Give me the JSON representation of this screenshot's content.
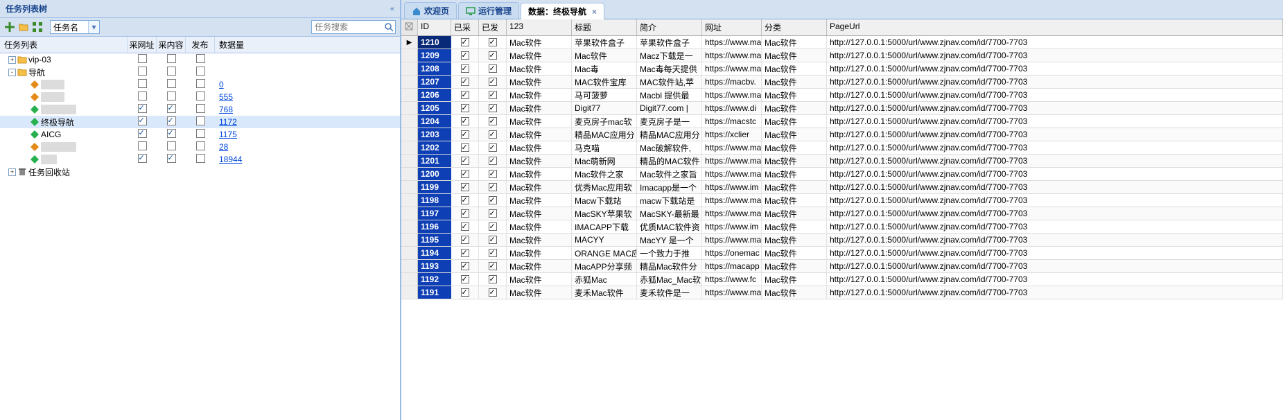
{
  "left": {
    "panel_title": "任务列表树",
    "combo_value": "任务名",
    "search_placeholder": "任务搜索",
    "columns": {
      "name": "任务列表",
      "c1": "采网址",
      "c2": "采内容",
      "c3": "发布",
      "c4": "数据量"
    },
    "tree": [
      {
        "depth": 0,
        "pm": "+",
        "icon": "folder",
        "label": "vip-03",
        "c1": false,
        "c2": false,
        "c3": false,
        "num": ""
      },
      {
        "depth": 0,
        "pm": "-",
        "icon": "folder",
        "label": "导航",
        "c1": false,
        "c2": false,
        "c3": false,
        "num": ""
      },
      {
        "depth": 1,
        "pm": "",
        "icon": "leaf-o",
        "label": "████",
        "ob": true,
        "c1": false,
        "c2": false,
        "c3": false,
        "num": "0"
      },
      {
        "depth": 1,
        "pm": "",
        "icon": "leaf-o",
        "label": "████",
        "ob": true,
        "c1": false,
        "c2": false,
        "c3": false,
        "num": "555"
      },
      {
        "depth": 1,
        "pm": "",
        "icon": "leaf-g",
        "label": "██████",
        "ob": true,
        "c1": true,
        "c2": true,
        "c3": false,
        "num": "768"
      },
      {
        "depth": 1,
        "pm": "",
        "icon": "leaf-g",
        "label": "终极导航",
        "sel": true,
        "c1": true,
        "c2": true,
        "c3": false,
        "num": "1172"
      },
      {
        "depth": 1,
        "pm": "",
        "icon": "leaf-g",
        "label": "AICG",
        "c1": true,
        "c2": true,
        "c3": false,
        "num": "1175"
      },
      {
        "depth": 1,
        "pm": "",
        "icon": "leaf-o",
        "label": "██████",
        "ob": true,
        "c1": false,
        "c2": false,
        "c3": false,
        "num": "28"
      },
      {
        "depth": 1,
        "pm": "",
        "icon": "leaf-g",
        "label": "██s",
        "ob": true,
        "c1": true,
        "c2": true,
        "c3": false,
        "num": "18944"
      },
      {
        "depth": 0,
        "pm": "+",
        "icon": "bin",
        "label": "任务回收站",
        "c1": null,
        "c2": null,
        "c3": null,
        "num": ""
      }
    ]
  },
  "right": {
    "tabs": [
      {
        "icon": "home",
        "label": "欢迎页",
        "close": false
      },
      {
        "icon": "monitor",
        "label": "运行管理",
        "close": false
      },
      {
        "icon": "",
        "label": "数据：终极导航",
        "close": true,
        "active": true
      }
    ],
    "columns": {
      "id": "ID",
      "c1": "已采",
      "c2": "已发",
      "c123": "123",
      "title": "标题",
      "desc": "简介",
      "url": "网址",
      "cat": "分类",
      "purl": "PageUrl"
    },
    "rows": [
      {
        "sel": true,
        "id": "1210",
        "a": "Mac软件",
        "t": "苹果软件盒子",
        "d": "苹果软件盒子",
        "u": "https://www.ma",
        "c": "Mac软件",
        "p": "http://127.0.0.1:5000/url/www.zjnav.com/id/7700-7703"
      },
      {
        "id": "1209",
        "a": "Mac软件",
        "t": "Mac软件",
        "d": "Macz下载是一",
        "u": "https://www.ma",
        "c": "Mac软件",
        "p": "http://127.0.0.1:5000/url/www.zjnav.com/id/7700-7703"
      },
      {
        "id": "1208",
        "a": "Mac软件",
        "t": "Mac毒",
        "d": "Mac毒每天提供",
        "u": "https://www.ma",
        "c": "Mac软件",
        "p": "http://127.0.0.1:5000/url/www.zjnav.com/id/7700-7703"
      },
      {
        "id": "1207",
        "a": "Mac软件",
        "t": "MAC软件宝库",
        "d": "MAC软件站,苹",
        "u": "https://macbv.",
        "c": "Mac软件",
        "p": "http://127.0.0.1:5000/url/www.zjnav.com/id/7700-7703"
      },
      {
        "id": "1206",
        "a": "Mac软件",
        "t": "马可菠萝",
        "d": "Macbl 提供最",
        "u": "https://www.ma",
        "c": "Mac软件",
        "p": "http://127.0.0.1:5000/url/www.zjnav.com/id/7700-7703"
      },
      {
        "id": "1205",
        "a": "Mac软件",
        "t": "Digit77",
        "d": "Digit77.com |",
        "u": "https://www.di",
        "c": "Mac软件",
        "p": "http://127.0.0.1:5000/url/www.zjnav.com/id/7700-7703"
      },
      {
        "id": "1204",
        "a": "Mac软件",
        "t": "麦克房子mac软",
        "d": "麦克房子是一",
        "u": "https://macstc",
        "c": "Mac软件",
        "p": "http://127.0.0.1:5000/url/www.zjnav.com/id/7700-7703"
      },
      {
        "id": "1203",
        "a": "Mac软件",
        "t": "精品MAC应用分",
        "d": "精品MAC应用分",
        "u": "https://xclier",
        "c": "Mac软件",
        "p": "http://127.0.0.1:5000/url/www.zjnav.com/id/7700-7703"
      },
      {
        "id": "1202",
        "a": "Mac软件",
        "t": "马克喵",
        "d": "Mac破解软件,",
        "u": "https://www.ma",
        "c": "Mac软件",
        "p": "http://127.0.0.1:5000/url/www.zjnav.com/id/7700-7703"
      },
      {
        "id": "1201",
        "a": "Mac软件",
        "t": "Mac萌新网",
        "d": "精品的MAC软件",
        "u": "https://www.ma",
        "c": "Mac软件",
        "p": "http://127.0.0.1:5000/url/www.zjnav.com/id/7700-7703"
      },
      {
        "id": "1200",
        "a": "Mac软件",
        "t": "Mac软件之家",
        "d": "Mac软件之家旨",
        "u": "https://www.ma",
        "c": "Mac软件",
        "p": "http://127.0.0.1:5000/url/www.zjnav.com/id/7700-7703"
      },
      {
        "id": "1199",
        "a": "Mac软件",
        "t": "优秀Mac应用软",
        "d": "Imacapp是一个",
        "u": "https://www.im",
        "c": "Mac软件",
        "p": "http://127.0.0.1:5000/url/www.zjnav.com/id/7700-7703"
      },
      {
        "id": "1198",
        "a": "Mac软件",
        "t": "Macw下载站",
        "d": "macw下载站是",
        "u": "https://www.ma",
        "c": "Mac软件",
        "p": "http://127.0.0.1:5000/url/www.zjnav.com/id/7700-7703"
      },
      {
        "id": "1197",
        "a": "Mac软件",
        "t": "MacSKY苹果软",
        "d": "MacSKY-最新最",
        "u": "https://www.ma",
        "c": "Mac软件",
        "p": "http://127.0.0.1:5000/url/www.zjnav.com/id/7700-7703"
      },
      {
        "id": "1196",
        "a": "Mac软件",
        "t": "IMACAPP下载",
        "d": "优质MAC软件资",
        "u": "https://www.im",
        "c": "Mac软件",
        "p": "http://127.0.0.1:5000/url/www.zjnav.com/id/7700-7703"
      },
      {
        "id": "1195",
        "a": "Mac软件",
        "t": "MACYY",
        "d": "MacYY 是一个",
        "u": "https://www.ma",
        "c": "Mac软件",
        "p": "http://127.0.0.1:5000/url/www.zjnav.com/id/7700-7703"
      },
      {
        "id": "1194",
        "a": "Mac软件",
        "t": "ORANGE MAC应",
        "d": "一个致力于推",
        "u": "https://onemac",
        "c": "Mac软件",
        "p": "http://127.0.0.1:5000/url/www.zjnav.com/id/7700-7703"
      },
      {
        "id": "1193",
        "a": "Mac软件",
        "t": "MacAPP分享频",
        "d": "精品Mac软件分",
        "u": "https://macapp",
        "c": "Mac软件",
        "p": "http://127.0.0.1:5000/url/www.zjnav.com/id/7700-7703"
      },
      {
        "id": "1192",
        "a": "Mac软件",
        "t": "赤狐Mac",
        "d": "赤狐Mac_Mac软",
        "u": "https://www.fc",
        "c": "Mac软件",
        "p": "http://127.0.0.1:5000/url/www.zjnav.com/id/7700-7703"
      },
      {
        "id": "1191",
        "a": "Mac软件",
        "t": "麦禾Mac软件",
        "d": "麦禾软件是一",
        "u": "https://www.ma",
        "c": "Mac软件",
        "p": "http://127.0.0.1:5000/url/www.zjnav.com/id/7700-7703"
      }
    ]
  }
}
